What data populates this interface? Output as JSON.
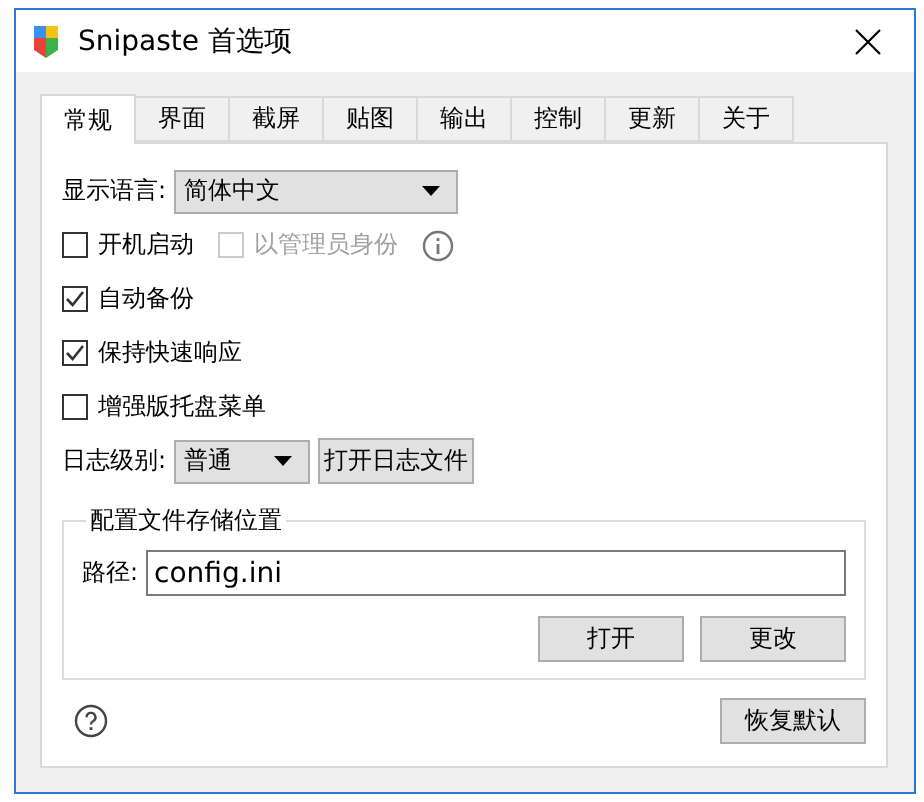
{
  "window": {
    "title": "Snipaste 首选项"
  },
  "tabs": [
    {
      "label": "常规",
      "selected": true
    },
    {
      "label": "界面",
      "selected": false
    },
    {
      "label": "截屏",
      "selected": false
    },
    {
      "label": "贴图",
      "selected": false
    },
    {
      "label": "输出",
      "selected": false
    },
    {
      "label": "控制",
      "selected": false
    },
    {
      "label": "更新",
      "selected": false
    },
    {
      "label": "关于",
      "selected": false
    }
  ],
  "language": {
    "label": "显示语言:",
    "value": "简体中文"
  },
  "checkbox_rows": [
    {
      "items": [
        {
          "label": "开机启动",
          "checked": false,
          "disabled": false
        },
        {
          "label": "以管理员身份",
          "checked": false,
          "disabled": true
        }
      ],
      "info": true
    },
    {
      "items": [
        {
          "label": "自动备份",
          "checked": true,
          "disabled": false
        }
      ],
      "info": false
    },
    {
      "items": [
        {
          "label": "保持快速响应",
          "checked": true,
          "disabled": false
        }
      ],
      "info": false
    },
    {
      "items": [
        {
          "label": "增强版托盘菜单",
          "checked": false,
          "disabled": false
        }
      ],
      "info": false
    }
  ],
  "log": {
    "label": "日志级别:",
    "value": "普通",
    "button": "打开日志文件"
  },
  "config_group": {
    "title": "配置文件存储位置",
    "path_label": "路径:",
    "path_value": "config.ini",
    "buttons": [
      "打开",
      "更改"
    ]
  },
  "footer": {
    "button": "恢复默认"
  }
}
